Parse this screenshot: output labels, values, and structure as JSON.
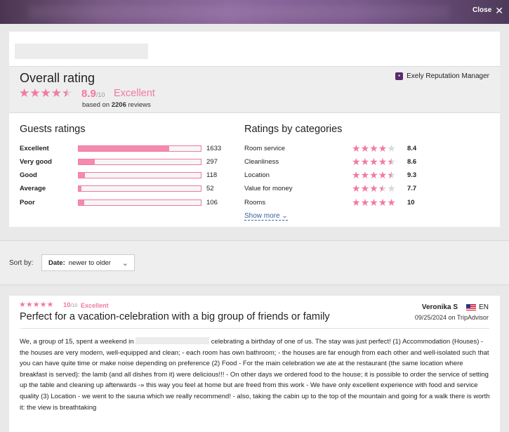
{
  "topbar": {
    "close_label": "Close"
  },
  "colors": {
    "accent": "#f07aa3",
    "star_empty": "#d9d9d9",
    "link": "#3a5f9e"
  },
  "overall": {
    "title": "Overall rating",
    "stars": 4.5,
    "score": "8.9",
    "out_of": "/10",
    "label": "Excellent",
    "based_prefix": "based on",
    "review_count": "2206",
    "based_suffix": "reviews",
    "brand": "Exely Reputation Manager"
  },
  "guests": {
    "title": "Guests ratings",
    "rows": [
      {
        "label": "Excellent",
        "count": "1633",
        "fraction": 0.74
      },
      {
        "label": "Very good",
        "count": "297",
        "fraction": 0.135
      },
      {
        "label": "Good",
        "count": "118",
        "fraction": 0.054
      },
      {
        "label": "Average",
        "count": "52",
        "fraction": 0.024
      },
      {
        "label": "Poor",
        "count": "106",
        "fraction": 0.048
      }
    ]
  },
  "categories": {
    "title": "Ratings by categories",
    "rows": [
      {
        "label": "Room service",
        "score": "8.4",
        "stars": 4
      },
      {
        "label": "Cleanliness",
        "score": "8.6",
        "stars": 4.5
      },
      {
        "label": "Location",
        "score": "9.3",
        "stars": 4.5
      },
      {
        "label": "Value for money",
        "score": "7.7",
        "stars": 3.5
      },
      {
        "label": "Rooms",
        "score": "10",
        "stars": 5
      }
    ],
    "show_more": "Show more"
  },
  "sort": {
    "label": "Sort by:",
    "field": "Date:",
    "value": "newer to older"
  },
  "review": {
    "stars": 5,
    "score": "10",
    "out_of": "/10",
    "label": "Excellent",
    "title": "Perfect for a vacation-celebration with a big group of friends or family",
    "author": "Veronika S",
    "lang": "EN",
    "date": "09/25/2024 on TripAdvisor",
    "text_before": "We, a group of 15, spent a weekend in",
    "text_after": "celebrating a birthday of one of us. The stay was just perfect! (1) Accommodation (Houses) - the houses are very modern, well-equipped and clean; - each room has own bathroom; - the houses are far enough from each other and well-isolated such that you can have quite time or make noise depending on preference (2) Food - For the main celebration we ate at the restaurant (the same location where breakfast is served): the lamb (and all dishes from it) were delicious!!! - On other days we ordered food to the house; it is possible to order the service of setting up the table and cleaning up afterwards -» this way you feel at home but are freed from this work - We have only excellent experience with food and service quality (3) Location - we went to the sauna which we really recommend! - also, taking the cabin up to the top of the mountain and going for a walk there is worth it: the view is breathtaking"
  }
}
